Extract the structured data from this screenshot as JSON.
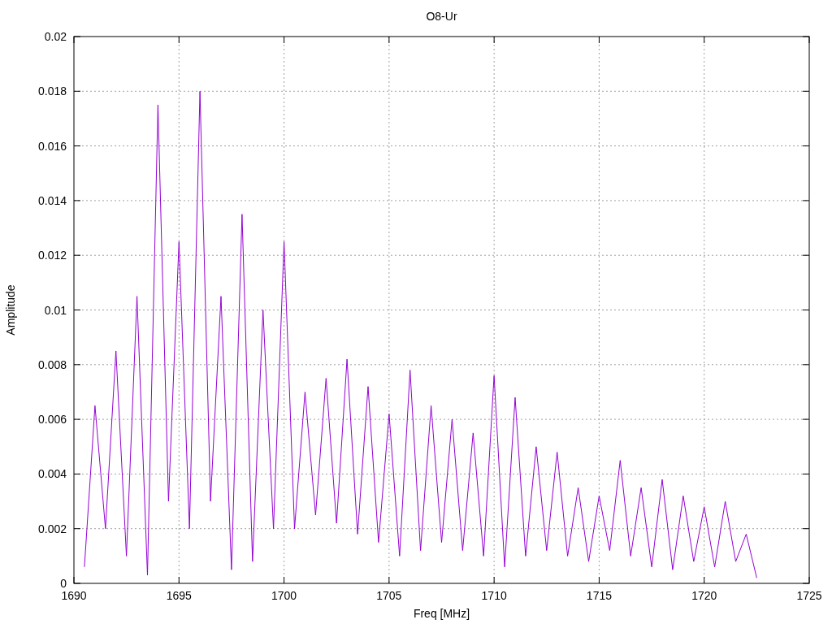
{
  "chart_data": {
    "type": "line",
    "title": "O8-Ur",
    "xlabel": "Freq [MHz]",
    "ylabel": "Amplitude",
    "grid": true,
    "xlim": [
      1690,
      1725
    ],
    "ylim": [
      0,
      0.02
    ],
    "xticks": [
      1690,
      1695,
      1700,
      1705,
      1710,
      1715,
      1720,
      1725
    ],
    "yticks": [
      0,
      0.002,
      0.004,
      0.006,
      0.008,
      0.01,
      0.012,
      0.014,
      0.016,
      0.018,
      0.02
    ],
    "x": [
      1690.5,
      1691,
      1691.5,
      1692,
      1692.5,
      1693,
      1693.5,
      1694,
      1694.5,
      1695,
      1695.5,
      1696,
      1696.5,
      1697,
      1697.5,
      1698,
      1698.5,
      1699,
      1699.5,
      1700,
      1700.5,
      1701,
      1701.5,
      1702,
      1702.5,
      1703,
      1703.5,
      1704,
      1704.5,
      1705,
      1705.5,
      1706,
      1706.5,
      1707,
      1707.5,
      1708,
      1708.5,
      1709,
      1709.5,
      1710,
      1710.5,
      1711,
      1711.5,
      1712,
      1712.5,
      1713,
      1713.5,
      1714,
      1714.5,
      1715,
      1715.5,
      1716,
      1716.5,
      1717,
      1717.5,
      1718,
      1718.5,
      1719,
      1719.5,
      1720,
      1720.5,
      1721,
      1721.5,
      1722,
      1722.5
    ],
    "series": [
      {
        "color": "#9400d3",
        "values": [
          0.0006,
          0.0065,
          0.002,
          0.0085,
          0.001,
          0.0105,
          0.0003,
          0.0175,
          0.003,
          0.0125,
          0.002,
          0.018,
          0.003,
          0.0105,
          0.0005,
          0.0135,
          0.0008,
          0.01,
          0.002,
          0.0125,
          0.002,
          0.007,
          0.0025,
          0.0075,
          0.0022,
          0.0082,
          0.0018,
          0.0072,
          0.0015,
          0.0062,
          0.001,
          0.0078,
          0.0012,
          0.0065,
          0.0015,
          0.006,
          0.0012,
          0.0055,
          0.001,
          0.0076,
          0.0006,
          0.0068,
          0.001,
          0.005,
          0.0012,
          0.0048,
          0.001,
          0.0035,
          0.0008,
          0.0032,
          0.0012,
          0.0045,
          0.001,
          0.0035,
          0.0006,
          0.0038,
          0.0005,
          0.0032,
          0.0008,
          0.0028,
          0.0006,
          0.003,
          0.0008,
          0.0018,
          0.0002
        ]
      }
    ]
  }
}
